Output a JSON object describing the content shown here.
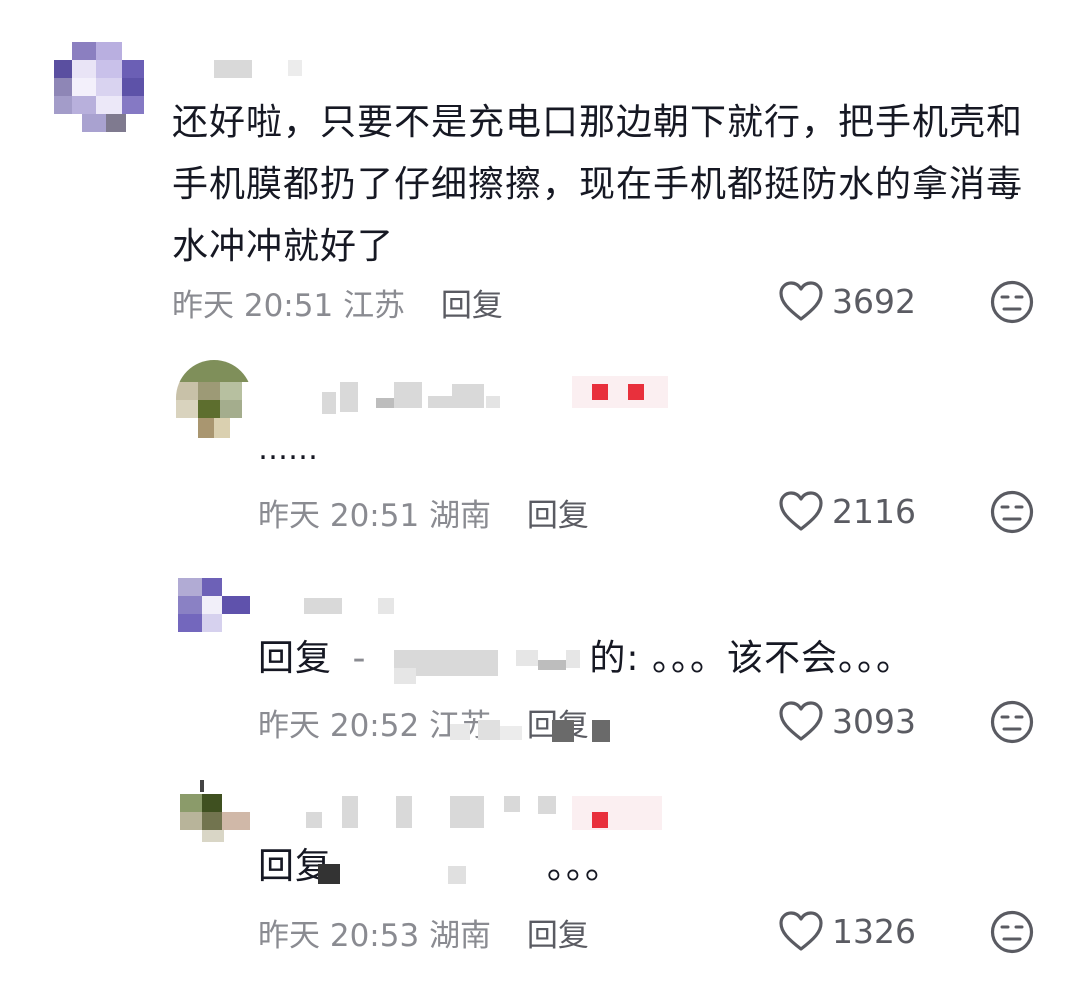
{
  "comments": [
    {
      "text": "还好啦，只要不是充电口那边朝下就行，把手机壳和手机膜都扔了仔细擦擦，现在手机都挺防水的拿消毒水冲冲就好了",
      "lines": [
        "还好啦，只要不是充电口那边朝下就行，把手机壳和",
        "手机膜都扔了仔细擦擦，现在手机都挺防水的拿消毒",
        "水冲冲就好了"
      ],
      "time": "昨天 20:51",
      "location": "江苏",
      "reply_label": "回复",
      "likes": "3692",
      "like_icon": "heart-outline-icon",
      "dislike_icon": "neutral-face-icon"
    },
    {
      "text": "……",
      "time": "昨天 20:51",
      "location": "湖南",
      "reply_label": "回复",
      "likes": "2116"
    },
    {
      "text_prefix": "回复",
      "text_dash": "-",
      "text_suffix": "的: 。。。该不会。。。",
      "time": "昨天 20:52",
      "location": "江苏",
      "reply_label": "回复",
      "likes": "3093"
    },
    {
      "text_prefix": "回复",
      "text_suffix": "。。。",
      "time": "昨天 20:53",
      "location": "湖南",
      "reply_label": "回复",
      "likes": "1326"
    }
  ],
  "colors": {
    "text_primary": "#161823",
    "text_meta": "#8a8b91",
    "red_badge": "#e8303c"
  }
}
